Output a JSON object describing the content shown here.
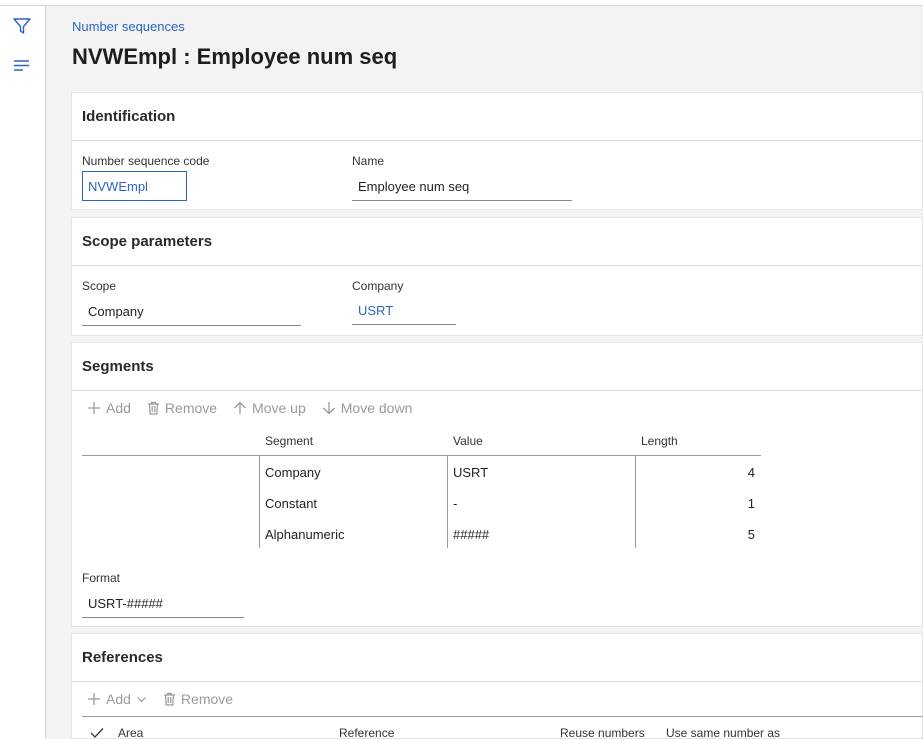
{
  "breadcrumb": "Number sequences",
  "page_title": "NVWEmpl : Employee num seq",
  "icons": {
    "filter": "filter-icon",
    "menu": "hamburger-menu-icon"
  },
  "identification": {
    "heading": "Identification",
    "code_label": "Number sequence code",
    "code_value": "NVWEmpl",
    "name_label": "Name",
    "name_value": "Employee num seq"
  },
  "scope": {
    "heading": "Scope parameters",
    "scope_label": "Scope",
    "scope_value": "Company",
    "company_label": "Company",
    "company_value": "USRT"
  },
  "segments": {
    "heading": "Segments",
    "toolbar": {
      "add": "Add",
      "remove": "Remove",
      "move_up": "Move up",
      "move_down": "Move down"
    },
    "columns": {
      "segment": "Segment",
      "value": "Value",
      "length": "Length"
    },
    "rows": [
      {
        "segment": "Company",
        "value": "USRT",
        "length": "4"
      },
      {
        "segment": "Constant",
        "value": "-",
        "length": "1"
      },
      {
        "segment": "Alphanumeric",
        "value": "#####",
        "length": "5"
      }
    ],
    "format_label": "Format",
    "format_value": "USRT-#####"
  },
  "references": {
    "heading": "References",
    "toolbar": {
      "add": "Add",
      "remove": "Remove"
    },
    "columns": {
      "area": "Area",
      "reference": "Reference",
      "reuse": "Reuse numbers",
      "same_as": "Use same number as"
    }
  },
  "colors": {
    "link": "#2b65c2",
    "disabled": "#9a9a9a",
    "background": "#f3f3f3"
  }
}
